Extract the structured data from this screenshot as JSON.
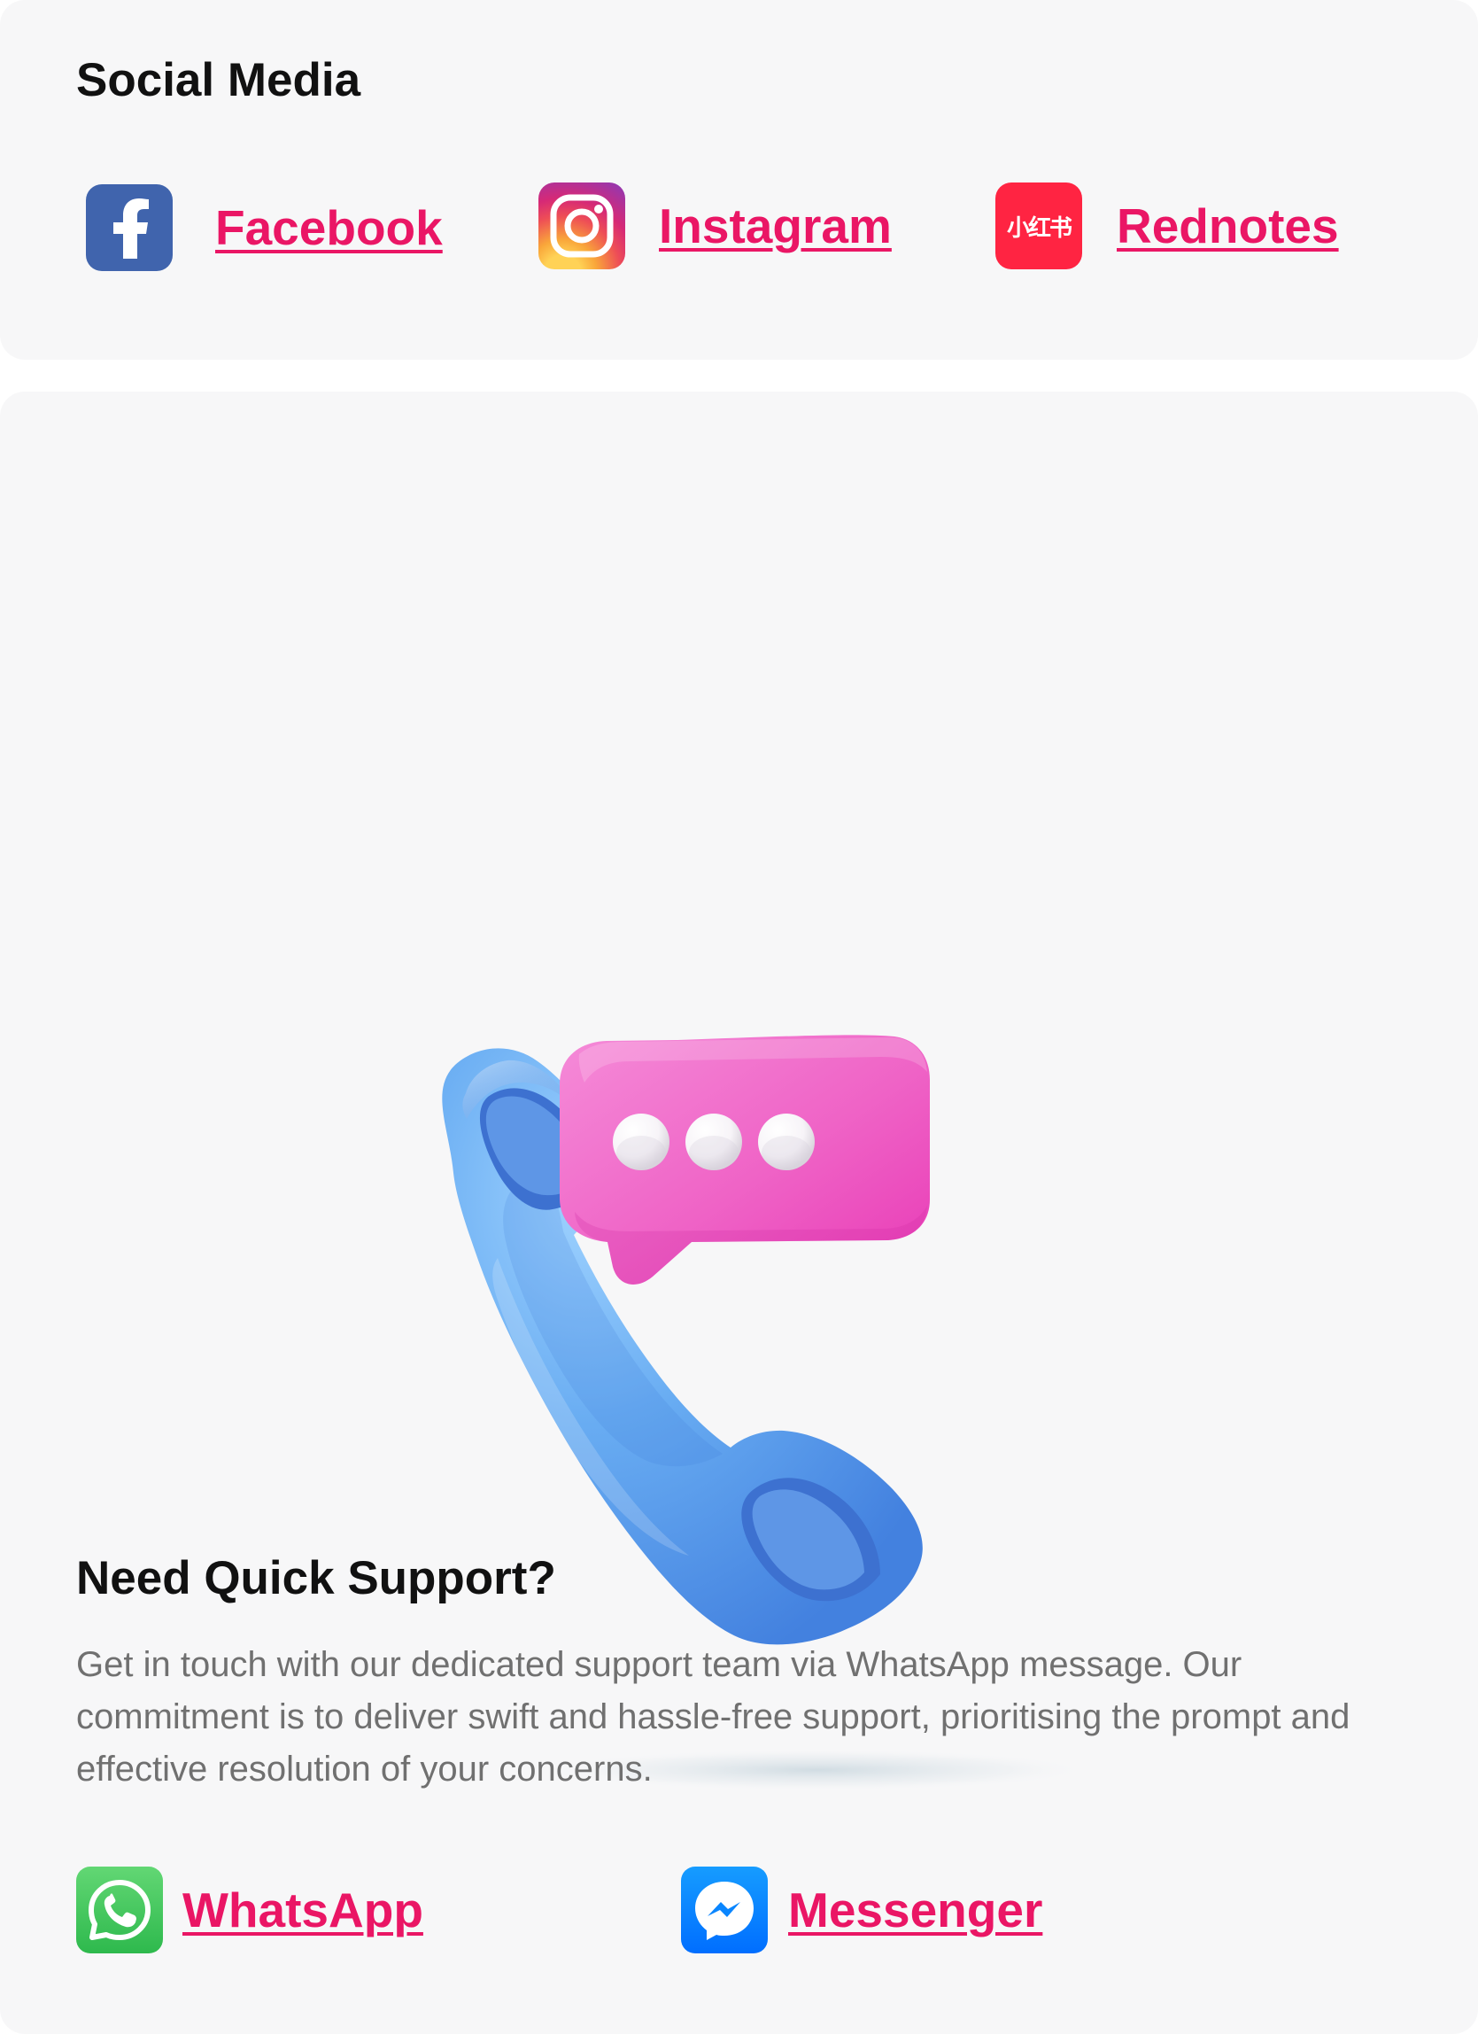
{
  "social_media": {
    "title": "Social Media",
    "links": [
      {
        "label": "Facebook",
        "icon": "facebook-icon",
        "color": "#4064ad"
      },
      {
        "label": "Instagram",
        "icon": "instagram-icon",
        "color": "#d62976"
      },
      {
        "label": "Rednotes",
        "icon": "rednotes-icon",
        "icon_text": "小红书",
        "color": "#ff2442"
      }
    ]
  },
  "support": {
    "title": "Need Quick Support?",
    "description": "Get in touch with our dedicated support team via WhatsApp message. Our commitment is to deliver swift and hassle-free support, prioritising the prompt and effective resolution of your concerns.",
    "links": [
      {
        "label": "WhatsApp",
        "icon": "whatsapp-icon",
        "color": "#2eb94d"
      },
      {
        "label": "Messenger",
        "icon": "messenger-icon",
        "color": "#006eff"
      }
    ],
    "illustration": "phone-chat-icon"
  },
  "colors": {
    "link": "#ea1665",
    "card_background": "#f7f7f8",
    "title": "#111111",
    "body_text": "#707070",
    "phone": "#5ca2ef",
    "chat_bubble": "#f064c8"
  }
}
